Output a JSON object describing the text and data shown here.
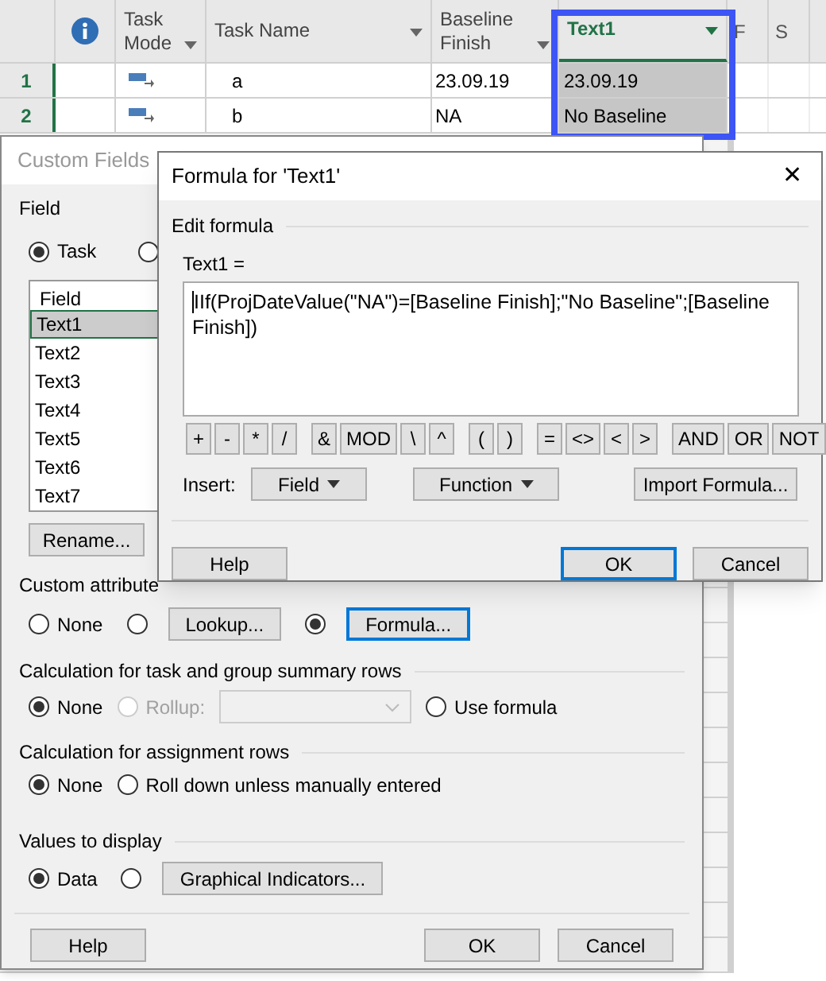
{
  "grid": {
    "columns": [
      {
        "kind": "info"
      },
      {
        "kind": "text",
        "label": "Task Mode",
        "selected": false
      },
      {
        "kind": "text",
        "label": "Task Name",
        "selected": false
      },
      {
        "kind": "text",
        "label": "Baseline Finish",
        "selected": false
      },
      {
        "kind": "text",
        "label": "Text1",
        "selected": true
      }
    ],
    "timescale": [
      "F",
      "S"
    ],
    "rows": [
      {
        "number": "1",
        "task_name": "a",
        "baseline_finish": "23.09.19",
        "text1": "23.09.19"
      },
      {
        "number": "2",
        "task_name": "b",
        "baseline_finish": "NA",
        "text1": "No Baseline"
      }
    ]
  },
  "custom_fields": {
    "title": "Custom Fields",
    "field_group": "Field",
    "type_options": [
      {
        "label": "Task",
        "selected": true
      },
      {
        "selected": false
      }
    ],
    "list_header": "Field",
    "fields": [
      {
        "label": "Text1",
        "selected": true
      },
      {
        "label": "Text2",
        "selected": false
      },
      {
        "label": "Text3",
        "selected": false
      },
      {
        "label": "Text4",
        "selected": false
      },
      {
        "label": "Text5",
        "selected": false
      },
      {
        "label": "Text6",
        "selected": false
      },
      {
        "label": "Text7",
        "selected": false
      }
    ],
    "rename_button": "Rename...",
    "custom_attributes": {
      "label": "Custom attribute",
      "options": [
        {
          "kind": "radio",
          "label": "None",
          "selected": false
        },
        {
          "kind": "radio-button",
          "button": "Lookup...",
          "selected": false,
          "focused": false
        },
        {
          "kind": "radio-button",
          "button": "Formula...",
          "selected": true,
          "focused": true
        }
      ]
    },
    "summary_rows": {
      "label": "Calculation for task and group summary rows",
      "options": [
        {
          "kind": "radio",
          "label": "None",
          "selected": true,
          "disabled": false
        },
        {
          "kind": "radio",
          "label": "Rollup:",
          "selected": false,
          "disabled": true
        },
        {
          "kind": "dropdown",
          "disabled": true
        },
        {
          "kind": "radio",
          "label": "Use formula",
          "selected": false,
          "disabled": false
        }
      ]
    },
    "assignment_rows": {
      "label": "Calculation for assignment rows",
      "options": [
        {
          "kind": "radio",
          "label": "None",
          "selected": true,
          "disabled": false
        },
        {
          "kind": "radio",
          "label": "Roll down unless manually entered",
          "selected": false,
          "disabled": false
        }
      ]
    },
    "values_to_display": {
      "label": "Values to display",
      "options": [
        {
          "kind": "radio",
          "label": "Data",
          "selected": true,
          "disabled": false
        },
        {
          "kind": "radio-button",
          "button": "Graphical Indicators...",
          "selected": false,
          "focused": false
        }
      ]
    },
    "buttons": [
      {
        "label": "Help",
        "default": false
      },
      {
        "label": "OK",
        "default": false
      },
      {
        "label": "Cancel",
        "default": false
      }
    ]
  },
  "formula_dialog": {
    "title": "Formula for 'Text1'",
    "close": "✕",
    "group": "Edit formula",
    "field_label": "Text1 =",
    "formula": "IIf(ProjDateValue(\"NA\")=[Baseline Finish];\"No Baseline\";[Baseline Finish])",
    "operator_groups": [
      [
        "+",
        "-",
        "*",
        "/"
      ],
      [
        "&",
        "MOD",
        "\\",
        "^"
      ],
      [
        "(",
        ")"
      ],
      [
        "=",
        "<>",
        "<",
        ">"
      ],
      [
        "AND",
        "OR",
        "NOT"
      ]
    ],
    "insert_label": "Insert:",
    "insert_buttons": [
      {
        "label": "Field",
        "kind": "menu"
      },
      {
        "label": "Function",
        "kind": "menu"
      },
      {
        "label": "Import Formula...",
        "kind": "plain"
      }
    ],
    "buttons": [
      {
        "label": "Help",
        "default": false
      },
      {
        "label": "OK",
        "default": true
      },
      {
        "label": "Cancel",
        "default": false
      }
    ]
  }
}
